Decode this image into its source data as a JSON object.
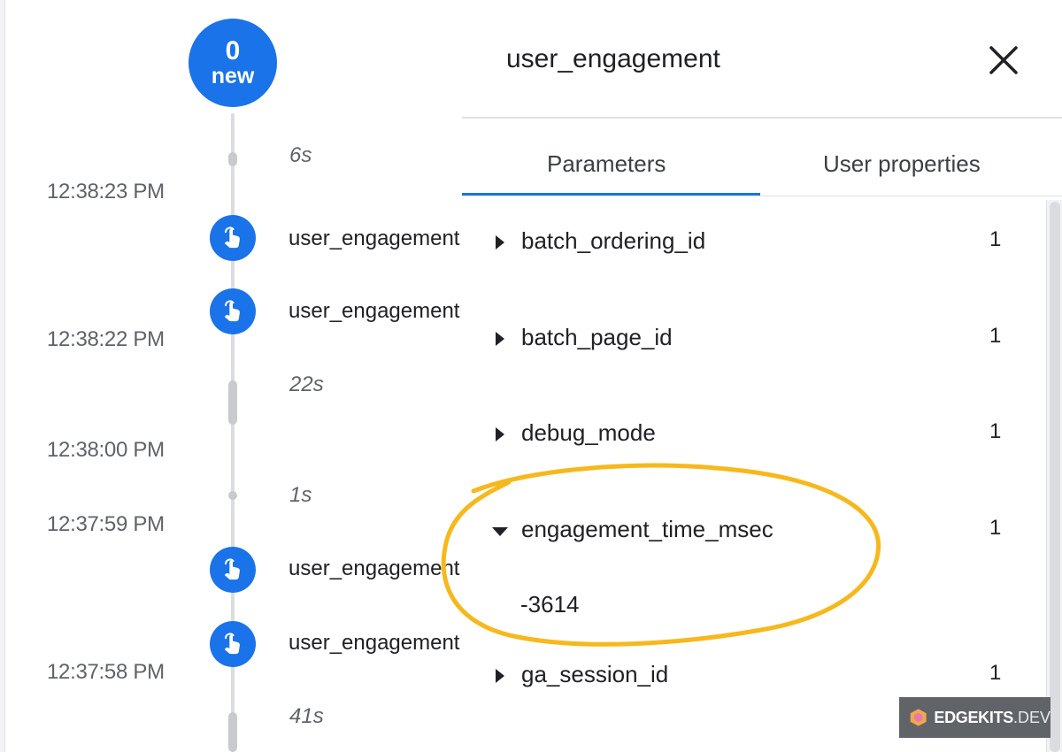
{
  "timeline": {
    "new_badge": {
      "count": "0",
      "label": "new"
    },
    "durations": [
      "6s",
      "22s",
      "1s",
      "41s"
    ],
    "times": [
      "12:38:23 PM",
      "12:38:22 PM",
      "12:38:00 PM",
      "12:37:59 PM",
      "12:37:58 PM"
    ],
    "events": [
      {
        "name": "user_engagement",
        "icon": "touch-icon"
      },
      {
        "name": "user_engagement",
        "icon": "touch-icon"
      },
      {
        "name": "user_engagement",
        "icon": "touch-icon"
      },
      {
        "name": "user_engagement",
        "icon": "touch-icon"
      }
    ]
  },
  "panel": {
    "title": "user_engagement",
    "close_icon": "close-icon",
    "tabs": [
      {
        "label": "Parameters",
        "active": true
      },
      {
        "label": "User properties",
        "active": false
      }
    ],
    "params": [
      {
        "name": "batch_ordering_id",
        "count": "1",
        "expanded": false
      },
      {
        "name": "batch_page_id",
        "count": "1",
        "expanded": false
      },
      {
        "name": "debug_mode",
        "count": "1",
        "expanded": false
      },
      {
        "name": "engagement_time_msec",
        "count": "1",
        "expanded": true,
        "value": "-3614"
      },
      {
        "name": "ga_session_id",
        "count": "1",
        "expanded": false
      }
    ]
  },
  "watermark": {
    "brand": "EDGEKITS",
    "tld": ".DEV"
  },
  "colors": {
    "accent": "#1a73e8",
    "annotation": "#f6b81c",
    "watermark_bg": "#606368"
  }
}
